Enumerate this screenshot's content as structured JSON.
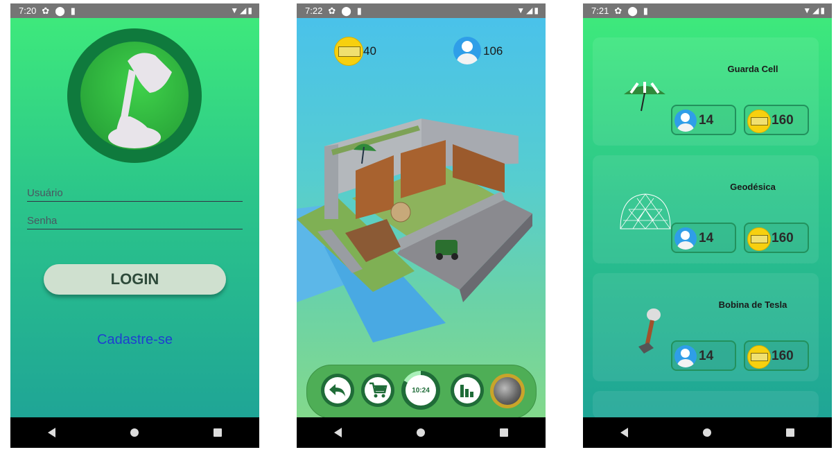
{
  "phone1": {
    "status_time": "7:20",
    "username_placeholder": "Usuário",
    "password_placeholder": "Senha",
    "login_label": "LOGIN",
    "signup_label": "Cadastre-se"
  },
  "phone2": {
    "status_time": "7:22",
    "coins": "40",
    "players": "106",
    "timer": "10:24",
    "toolbar": [
      {
        "name": "back-button",
        "icon": "undo-arrow-icon"
      },
      {
        "name": "shop-button",
        "icon": "cart-icon"
      },
      {
        "name": "stats-button",
        "icon": "bar-chart-icon"
      }
    ]
  },
  "phone3": {
    "status_time": "7:21",
    "items": [
      {
        "name": "Guarda Cell",
        "players": "14",
        "price": "160",
        "icon": "umbrella-icon"
      },
      {
        "name": "Geodésica",
        "players": "14",
        "price": "160",
        "icon": "geodesic-dome-icon"
      },
      {
        "name": "Bobina de Tesla",
        "players": "14",
        "price": "160",
        "icon": "tesla-coil-icon"
      }
    ]
  }
}
